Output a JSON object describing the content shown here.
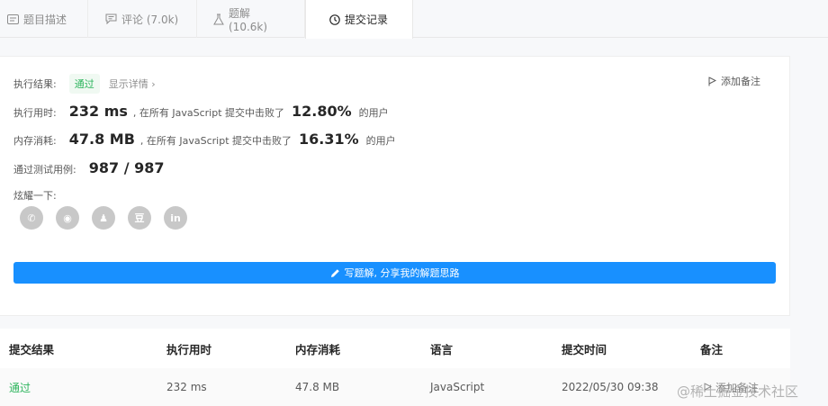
{
  "tabs": [
    {
      "label": "题目描述",
      "icon": "description-icon"
    },
    {
      "label": "评论 (7.0k)",
      "icon": "comment-icon"
    },
    {
      "label": "题解 (10.6k)",
      "icon": "flask-icon"
    },
    {
      "label": "提交记录",
      "icon": "clock-icon",
      "active": true
    }
  ],
  "result": {
    "label": "执行结果:",
    "status": "通过",
    "details_link": "显示详情 ›",
    "add_note": "添加备注"
  },
  "runtime": {
    "label": "执行用时:",
    "value": "232 ms",
    "middle": ", 在所有 JavaScript 提交中击败了",
    "percent": "12.80%",
    "suffix": "的用户"
  },
  "memory": {
    "label": "内存消耗:",
    "value": "47.8 MB",
    "middle": ", 在所有 JavaScript 提交中击败了",
    "percent": "16.31%",
    "suffix": "的用户"
  },
  "tests": {
    "label": "通过测试用例:",
    "value": "987 / 987"
  },
  "share": {
    "label": "炫耀一下:",
    "icons": [
      {
        "name": "wechat-icon",
        "glyph": "✆"
      },
      {
        "name": "weibo-icon",
        "glyph": "◉"
      },
      {
        "name": "qq-icon",
        "glyph": "♟"
      },
      {
        "name": "douban-icon",
        "glyph": "豆"
      },
      {
        "name": "linkedin-icon",
        "glyph": "in"
      }
    ]
  },
  "write_solution": "写题解, 分享我的解题思路",
  "table": {
    "headers": [
      "提交结果",
      "执行用时",
      "内存消耗",
      "语言",
      "提交时间",
      "备注"
    ],
    "rows": [
      {
        "status": "通过",
        "runtime": "232 ms",
        "memory": "47.8 MB",
        "language": "JavaScript",
        "time": "2022/05/30 09:38",
        "note": "添加备注"
      }
    ]
  },
  "watermark": "@稀土掘金技术社区",
  "colors": {
    "accent": "#1890ff",
    "success": "#2db55d"
  }
}
